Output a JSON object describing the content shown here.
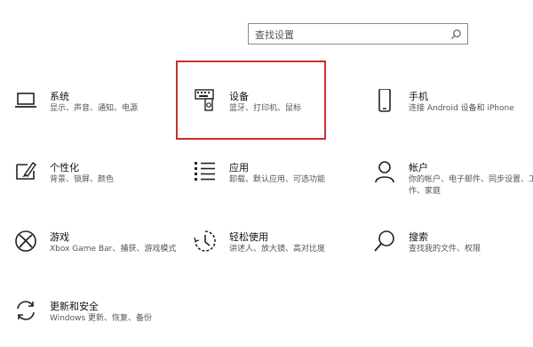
{
  "search": {
    "placeholder": "查找设置"
  },
  "tiles": [
    {
      "title": "系统",
      "desc": "显示、声音、通知、电源",
      "icon": "laptop-icon"
    },
    {
      "title": "设备",
      "desc": "蓝牙、打印机、鼠标",
      "icon": "devices-icon"
    },
    {
      "title": "手机",
      "desc": "连接 Android 设备和 iPhone",
      "icon": "phone-icon"
    },
    {
      "title": "个性化",
      "desc": "背景、锁屏、颜色",
      "icon": "personalization-icon"
    },
    {
      "title": "应用",
      "desc": "卸载、默认应用、可选功能",
      "icon": "apps-icon"
    },
    {
      "title": "帐户",
      "desc": "你的帐户、电子邮件、同步设置、工作、家庭",
      "icon": "account-icon"
    },
    {
      "title": "游戏",
      "desc": "Xbox Game Bar、捕获、游戏模式",
      "icon": "xbox-icon"
    },
    {
      "title": "轻松使用",
      "desc": "讲述人、放大镜、高对比度",
      "icon": "ease-of-access-icon"
    },
    {
      "title": "搜索",
      "desc": "查找我的文件、权限",
      "icon": "search-icon"
    },
    {
      "title": "更新和安全",
      "desc": "Windows 更新、恢复、备份",
      "icon": "update-icon"
    }
  ],
  "colors": {
    "highlight": "#c3322e",
    "text": "#111111",
    "subtext": "#555555"
  }
}
